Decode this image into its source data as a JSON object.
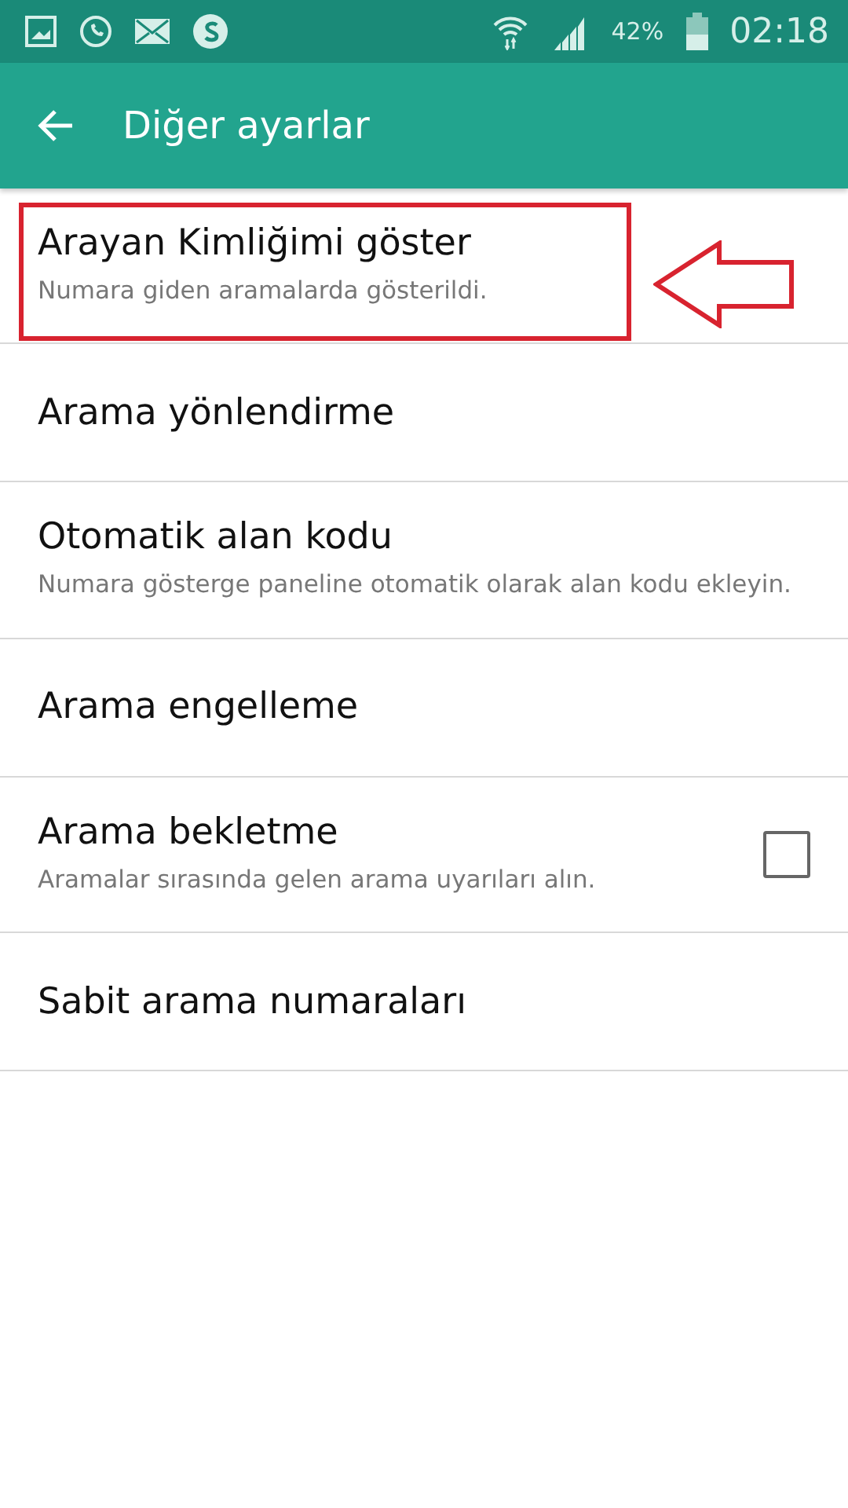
{
  "status_bar": {
    "battery_text": "42%",
    "time": "02:18"
  },
  "toolbar": {
    "title": "Diğer ayarlar"
  },
  "items": [
    {
      "kind": "plain",
      "title": "Arayan Kimliğimi göster",
      "subtitle": "Numara giden aramalarda gösterildi.",
      "highlighted": true
    },
    {
      "kind": "plain",
      "title": "Arama yönlendirme",
      "highlighted": false
    },
    {
      "kind": "plain",
      "title": "Otomatik alan kodu",
      "subtitle": "Numara gösterge paneline otomatik olarak alan kodu ekleyin.",
      "highlighted": false
    },
    {
      "kind": "plain",
      "title": "Arama engelleme",
      "highlighted": false
    },
    {
      "kind": "checkbox",
      "title": "Arama bekletme",
      "subtitle": "Aramalar sırasında gelen arama uyarıları alın.",
      "checked": false,
      "highlighted": false
    },
    {
      "kind": "plain",
      "title": "Sabit arama numaraları",
      "highlighted": false
    }
  ]
}
